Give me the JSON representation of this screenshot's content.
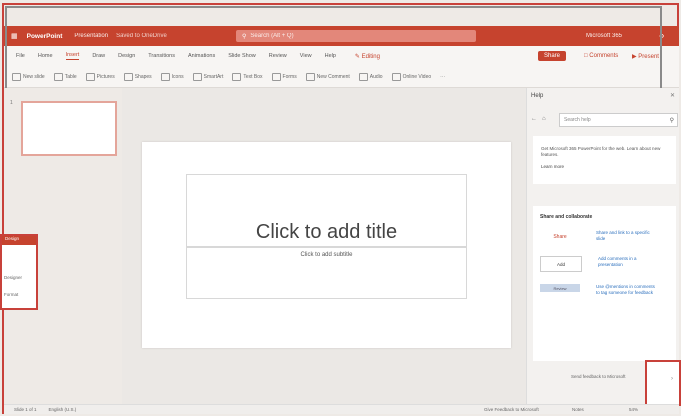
{
  "title_bar": {
    "app_name": "PowerPoint",
    "file_name": "Presentation",
    "save_status": "Saved to OneDrive",
    "search_placeholder": "Search (Alt + Q)",
    "account": "Microsoft 365",
    "color": "#c6432e"
  },
  "ribbon": {
    "tabs": [
      "File",
      "Home",
      "Insert",
      "Draw",
      "Design",
      "Transitions",
      "Animations",
      "Slide Show",
      "Review",
      "View",
      "Help"
    ],
    "active_tab": "Insert",
    "editing_label": "Editing",
    "share_label": "Share",
    "comments_label": "Comments",
    "present_label": "Present",
    "tools": [
      "New slide",
      "Table",
      "Pictures",
      "Shapes",
      "Icons",
      "SmartArt",
      "Text Box",
      "Forms",
      "New Comment",
      "Audio",
      "Online Video"
    ]
  },
  "slide": {
    "title_placeholder": "Click to add title",
    "subtitle_placeholder": "Click to add subtitle",
    "thumb_number": "1"
  },
  "help_pane": {
    "header": "Help",
    "search_placeholder": "Search help",
    "intro": "Get Microsoft 365 PowerPoint for the web. Learn about new features.",
    "intro_link": "Learn more",
    "section_title": "Share and collaborate",
    "items": [
      {
        "label": "Share",
        "text": "Share and link to a specific slide"
      },
      {
        "label": "Add",
        "text": "Add comments in a presentation"
      },
      {
        "label": "Review",
        "text": "Use @mentions in comments to tag someone for feedback"
      }
    ],
    "footer": "Send feedback to Microsoft"
  },
  "popup": {
    "header": "Design",
    "item1": "Designer",
    "item2": "Format"
  },
  "status_bar": {
    "slide_info": "Slide 1 of 1",
    "language": "English (U.S.)",
    "feedback": "Give Feedback to Microsoft",
    "notes": "Notes",
    "zoom": "54%"
  }
}
